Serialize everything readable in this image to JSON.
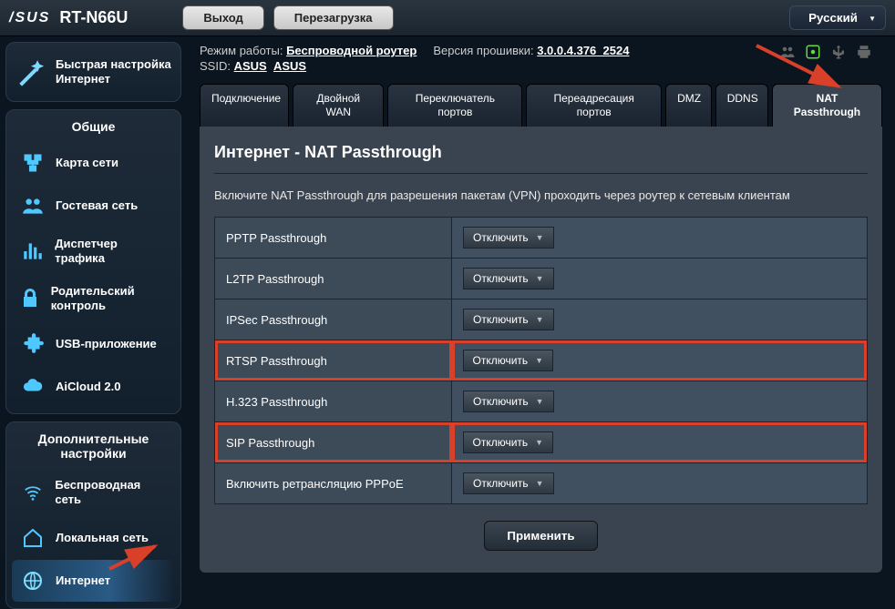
{
  "top": {
    "logo": "/SUS",
    "model": "RT-N66U",
    "logout": "Выход",
    "reboot": "Перезагрузка",
    "language": "Русский"
  },
  "info": {
    "mode_label": "Режим работы:",
    "mode_value": "Беспроводной роутер",
    "fw_label": "Версия прошивки:",
    "fw_value": "3.0.0.4.376_2524",
    "ssid_label": "SSID:",
    "ssid1": "ASUS",
    "ssid2": "ASUS"
  },
  "sidebar": {
    "quick_setup": "Быстрая настройка Интернет",
    "general_header": "Общие",
    "general": [
      "Карта сети",
      "Гостевая сеть",
      "Диспетчер трафика",
      "Родительский контроль",
      "USB-приложение",
      "AiCloud 2.0"
    ],
    "advanced_header": "Дополнительные настройки",
    "advanced": [
      "Беспроводная сеть",
      "Локальная сеть",
      "Интернет"
    ]
  },
  "tabs": [
    "Подключение",
    "Двойной WAN",
    "Переключатель портов",
    "Переадресация портов",
    "DMZ",
    "DDNS",
    "NAT Passthrough"
  ],
  "panel": {
    "title": "Интернет - NAT Passthrough",
    "desc": "Включите NAT Passthrough для разрешения пакетам (VPN) проходить через роутер к сетевым клиентам",
    "rows": [
      {
        "label": "PPTP Passthrough",
        "value": "Отключить",
        "hl": false
      },
      {
        "label": "L2TP Passthrough",
        "value": "Отключить",
        "hl": false
      },
      {
        "label": "IPSec Passthrough",
        "value": "Отключить",
        "hl": false
      },
      {
        "label": "RTSP Passthrough",
        "value": "Отключить",
        "hl": true
      },
      {
        "label": "H.323 Passthrough",
        "value": "Отключить",
        "hl": false
      },
      {
        "label": "SIP Passthrough",
        "value": "Отключить",
        "hl": true
      },
      {
        "label": "Включить ретрансляцию PPPoE",
        "value": "Отключить",
        "hl": false
      }
    ],
    "apply": "Применить"
  }
}
